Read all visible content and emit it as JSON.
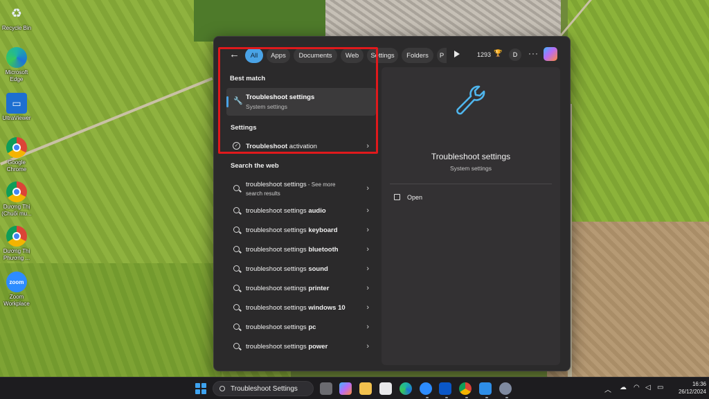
{
  "desktop": {
    "icons": [
      {
        "label": "Recycle Bin",
        "icon": "recycle-bin-icon"
      },
      {
        "label": "Microsoft Edge",
        "icon": "edge-icon"
      },
      {
        "label": "UltraViewer",
        "icon": "ultraviewer-icon"
      },
      {
        "label": "Google Chrome",
        "icon": "chrome-icon"
      },
      {
        "label": "Dương Thị (Chuối mu...",
        "icon": "chrome-profile-icon"
      },
      {
        "label": "Dương Thị Phương ...",
        "icon": "chrome-profile-icon"
      },
      {
        "label": "Zoom Workplace",
        "icon": "zoom-icon"
      }
    ]
  },
  "search": {
    "filters": [
      "All",
      "Apps",
      "Documents",
      "Web",
      "Settings",
      "Folders",
      "P"
    ],
    "active_filter": "All",
    "points": "1293",
    "avatar_initial": "D",
    "more": "···",
    "best_match_heading": "Best match",
    "best_match": {
      "title": "Troubleshoot settings",
      "subtitle": "System settings"
    },
    "settings_heading": "Settings",
    "settings_item": {
      "bold": "Troubleshoot",
      "rest": " activation"
    },
    "web_heading": "Search the web",
    "web_results": [
      {
        "base": "troubleshoot settings",
        "bold": "",
        "suffix": " - See more",
        "sub": "search results"
      },
      {
        "base": "troubleshoot settings ",
        "bold": "audio"
      },
      {
        "base": "troubleshoot settings ",
        "bold": "keyboard"
      },
      {
        "base": "troubleshoot settings ",
        "bold": "bluetooth"
      },
      {
        "base": "troubleshoot settings ",
        "bold": "sound"
      },
      {
        "base": "troubleshoot settings ",
        "bold": "printer"
      },
      {
        "base": "troubleshoot settings ",
        "bold": "windows 10"
      },
      {
        "base": "troubleshoot settings ",
        "bold": "pc"
      },
      {
        "base": "troubleshoot settings ",
        "bold": "power"
      }
    ],
    "detail": {
      "title": "Troubleshoot settings",
      "subtitle": "System settings",
      "open_label": "Open"
    }
  },
  "taskbar": {
    "search_text": "Troubleshoot Settings",
    "time": "16:36",
    "date": "26/12/2024"
  },
  "colors": {
    "accent": "#4aa3e6",
    "highlight": "#e0191c",
    "panel": "#2b2a2b"
  }
}
